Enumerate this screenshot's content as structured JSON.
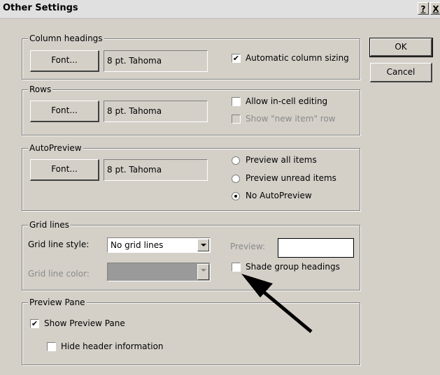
{
  "title": "Other Settings",
  "help_label": "?",
  "close_label": "X",
  "ok_label": "OK",
  "cancel_label": "Cancel",
  "column_headings": {
    "title": "Column headings",
    "font_button": "Font...",
    "font_value": "8 pt. Tahoma",
    "auto_sizing_label": "Automatic column sizing",
    "auto_sizing_checked": true
  },
  "rows": {
    "title": "Rows",
    "font_button": "Font...",
    "font_value": "8 pt. Tahoma",
    "in_cell_editing_label": "Allow in-cell editing",
    "new_item_row_label": "Show \"new item\" row"
  },
  "autopreview": {
    "title": "AutoPreview",
    "font_button": "Font...",
    "font_value": "8 pt. Tahoma",
    "options": [
      "Preview all items",
      "Preview unread items",
      "No AutoPreview"
    ],
    "selected": "No AutoPreview"
  },
  "grid_lines": {
    "title": "Grid lines",
    "style_label": "Grid line style:",
    "style_value": "No grid lines",
    "color_label": "Grid line color:",
    "preview_label": "Preview:",
    "shade_label": "Shade group headings"
  },
  "preview_pane": {
    "title": "Preview Pane",
    "show_label": "Show Preview Pane",
    "show_checked": true,
    "hide_header_label": "Hide header information"
  },
  "colors": {
    "dialog_bg": "#d4d0c8",
    "arrow": "#000000"
  },
  "icons": [
    "check-mark-icon",
    "radio-dot-icon",
    "dropdown-arrow-icon",
    "annotation-arrow-icon"
  ]
}
